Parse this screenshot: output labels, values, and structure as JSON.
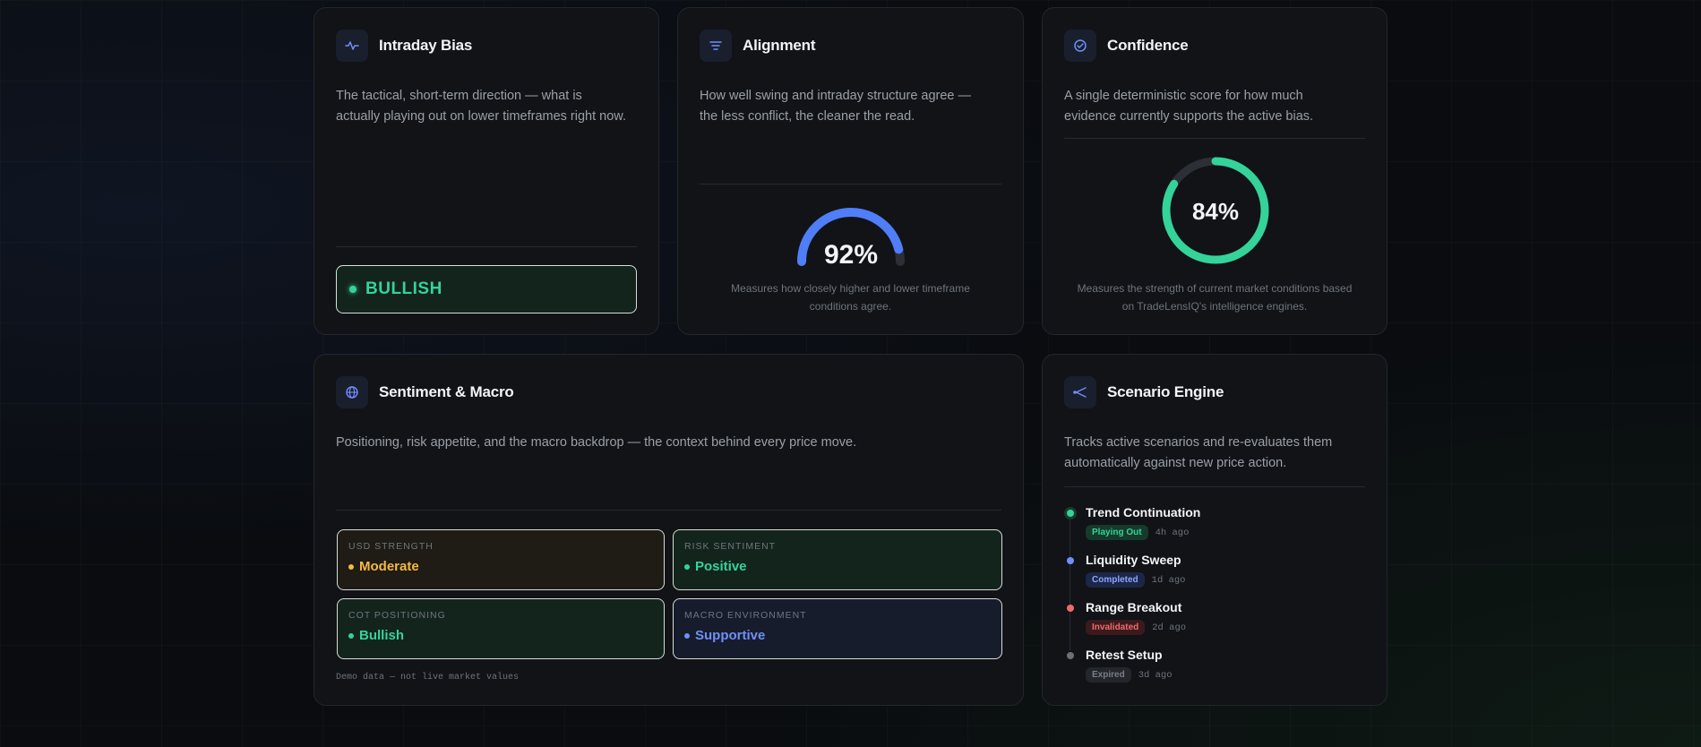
{
  "cards": {
    "intraday": {
      "title": "Intraday Bias",
      "icon": "activity-pulse-icon",
      "desc_line1": "The tactical, short-term direction — what is",
      "desc_line2": "actually playing out on lower timeframes right now.",
      "bias": "BULLISH",
      "bias_color": "#34d399"
    },
    "alignment": {
      "title": "Alignment",
      "icon": "filter-lines-icon",
      "desc_line1": "How well swing and intraday structure agree —",
      "desc_line2": "the less conflict, the cleaner the read.",
      "value_label": "92%",
      "value": 92,
      "caption_line1": "Measures how closely higher and lower timeframe",
      "caption_line2": "conditions agree.",
      "accent": "#4f7ef8"
    },
    "confidence": {
      "title": "Confidence",
      "icon": "check-circle-icon",
      "desc_line1": "A single deterministic score for how much",
      "desc_line2": "evidence currently supports the active bias.",
      "value_label": "84%",
      "value": 84,
      "caption_line1": "Measures the strength of current market conditions based",
      "caption_line2": "on TradeLensIQ's intelligence engines.",
      "accent": "#34d399"
    },
    "sentiment": {
      "title": "Sentiment & Macro",
      "icon": "globe-icon",
      "desc": "Positioning, risk appetite, and the macro backdrop — the context behind every price move.",
      "metrics": [
        {
          "label": "USD STRENGTH",
          "value": "Moderate",
          "color": "#f5b942"
        },
        {
          "label": "RISK SENTIMENT",
          "value": "Positive",
          "color": "#34d399"
        },
        {
          "label": "COT POSITIONING",
          "value": "Bullish",
          "color": "#34d399"
        },
        {
          "label": "MACRO ENVIRONMENT",
          "value": "Supportive",
          "color": "#6f8ff8"
        }
      ],
      "note": "Demo data — not live market values"
    },
    "scenario": {
      "title": "Scenario Engine",
      "icon": "branch-split-icon",
      "desc_line1": "Tracks active scenarios and re-evaluates them",
      "desc_line2": "automatically against new price action.",
      "items": [
        {
          "title": "Trend Continuation",
          "status": "Playing Out",
          "time": "4h ago",
          "color": "#34d399"
        },
        {
          "title": "Liquidity Sweep",
          "status": "Completed",
          "time": "1d ago",
          "color": "#6f8ff8"
        },
        {
          "title": "Range Breakout",
          "status": "Invalidated",
          "time": "2d ago",
          "color": "#ef6b6b"
        },
        {
          "title": "Retest Setup",
          "status": "Expired",
          "time": "3d ago",
          "color": "#6b7078"
        }
      ]
    }
  }
}
